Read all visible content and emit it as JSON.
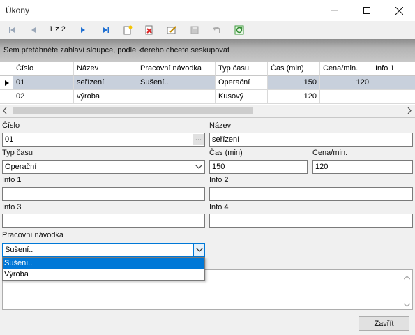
{
  "window": {
    "title": "Úkony"
  },
  "navigator": {
    "position": "1 z 2",
    "icons": [
      "first-icon",
      "prev-icon",
      "next-icon",
      "last-icon",
      "new-icon",
      "delete-icon",
      "edit-icon",
      "save-icon",
      "undo-icon",
      "refresh-icon"
    ]
  },
  "groupbar": {
    "text": "Sem přetáhněte záhlaví sloupce, podle kterého chcete seskupovat"
  },
  "grid": {
    "headers": [
      "Číslo",
      "Název",
      "Pracovní návodka",
      "Typ času",
      "Čas (min)",
      "Cena/min.",
      "Info 1"
    ],
    "rows": [
      [
        "01",
        "seřízení",
        "Sušení..",
        "Operační",
        "150",
        "120",
        ""
      ],
      [
        "02",
        "výroba",
        "",
        "Kusový",
        "120",
        "",
        ""
      ]
    ]
  },
  "form": {
    "cislo_label": "Číslo",
    "cislo_value": "01",
    "nazev_label": "Název",
    "nazev_value": "seřízení",
    "typ_casu_label": "Typ času",
    "typ_casu_value": "Operační",
    "cas_label": "Čas (min)",
    "cas_value": "150",
    "cena_label": "Cena/min.",
    "cena_value": "120",
    "info1_label": "Info 1",
    "info1_value": "",
    "info2_label": "Info 2",
    "info2_value": "",
    "info3_label": "Info 3",
    "info3_value": "",
    "info4_label": "Info 4",
    "info4_value": "",
    "navodka_label": "Pracovní návodka",
    "navodka_value": "Sušení..",
    "navodka_options": [
      "Sušení..",
      "Výroba"
    ]
  },
  "buttons": {
    "close_label": "Zavřít"
  },
  "colors": {
    "selection": "#0078d7",
    "selected_row": "#c8d0dc"
  }
}
